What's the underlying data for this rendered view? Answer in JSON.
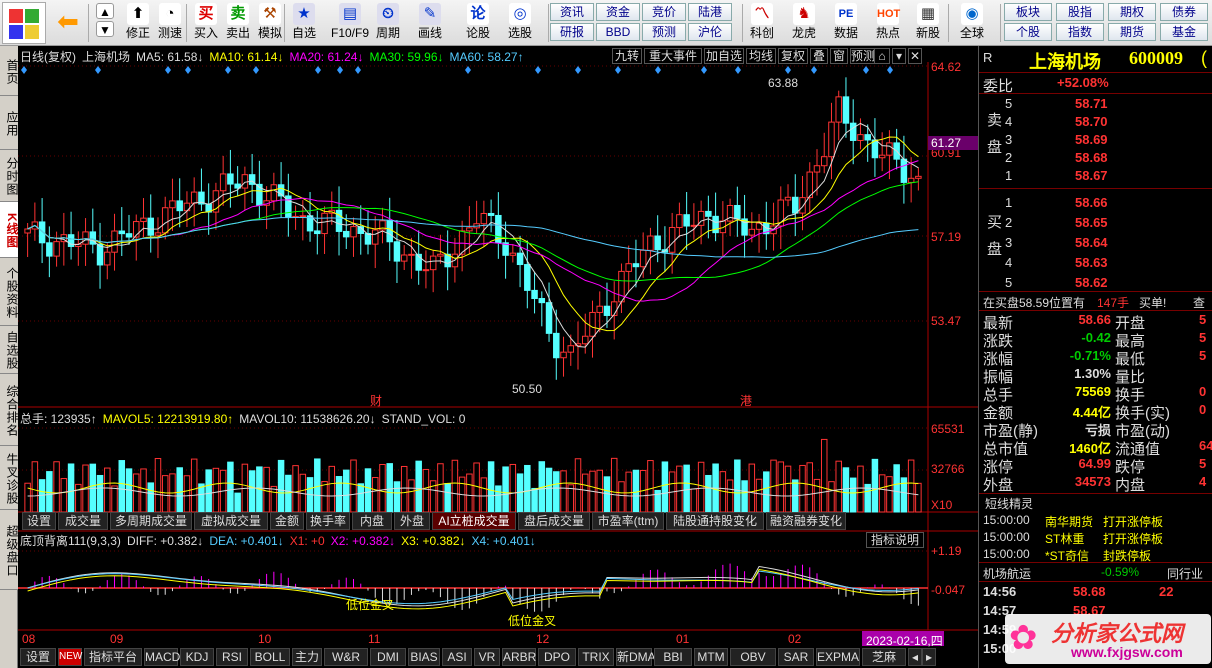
{
  "toolbar": {
    "buttons": [
      {
        "label": "修正",
        "icon": "wrench-icon",
        "glyph": "⬆",
        "bg": "#fff"
      },
      {
        "label": "测速",
        "icon": "speed-icon",
        "glyph": "◔",
        "bg": "#fff"
      },
      {
        "label": "买入",
        "icon": "buy-icon",
        "glyph": "买",
        "bg": "#fff",
        "color": "#d00"
      },
      {
        "label": "卖出",
        "icon": "sell-icon",
        "glyph": "卖",
        "bg": "#fff",
        "color": "#090"
      },
      {
        "label": "模拟",
        "icon": "hammer-icon",
        "glyph": "⚒",
        "bg": "#fff",
        "color": "#a40"
      },
      {
        "label": "自选",
        "icon": "star-icon",
        "glyph": "★",
        "bg": "#dde",
        "color": "#03c"
      },
      {
        "label": "F10/F9",
        "icon": "f10-icon",
        "glyph": "▤",
        "bg": "#dde",
        "color": "#03c"
      },
      {
        "label": "周期",
        "icon": "clock-icon",
        "glyph": "⏲",
        "bg": "#dde",
        "color": "#03c"
      },
      {
        "label": "画线",
        "icon": "pencil-icon",
        "glyph": "✎",
        "bg": "#dde",
        "color": "#03c"
      },
      {
        "label": "论股",
        "icon": "forum-icon",
        "glyph": "论",
        "bg": "#fff",
        "color": "#03c"
      },
      {
        "label": "选股",
        "icon": "pick-icon",
        "glyph": "◎",
        "bg": "#fff",
        "color": "#03c"
      },
      {
        "label": "科创",
        "icon": "chart-icon",
        "glyph": "〽",
        "bg": "#fff",
        "color": "#c00"
      },
      {
        "label": "龙虎",
        "icon": "dragon-icon",
        "glyph": "♞",
        "bg": "#fff",
        "color": "#c00"
      },
      {
        "label": "数据",
        "icon": "pe-icon",
        "glyph": "PE",
        "bg": "#fff",
        "color": "#03c"
      },
      {
        "label": "热点",
        "icon": "hot-icon",
        "glyph": "HOT",
        "bg": "#fff",
        "color": "#f40"
      },
      {
        "label": "新股",
        "icon": "calendar-icon",
        "glyph": "▦",
        "bg": "#fff",
        "color": "#333"
      },
      {
        "label": "全球",
        "icon": "globe-icon",
        "glyph": "◉",
        "bg": "#fff",
        "color": "#06c"
      }
    ],
    "grid": [
      "资讯",
      "资金",
      "竞价",
      "陆港",
      "研报",
      "BBD",
      "预测",
      "沪伦"
    ],
    "grid2": [
      "板块",
      "股指",
      "期权",
      "债券",
      "个股",
      "指数",
      "期货",
      "基金"
    ]
  },
  "left_tabs": [
    "首页",
    "应用",
    "分时图",
    "K线图",
    "个股资料",
    "自选股",
    "综合排名",
    "牛叉诊股",
    "超级盘口"
  ],
  "chart": {
    "title_items": [
      {
        "text": "日线(复权)",
        "color": "#ddd"
      },
      {
        "text": "上海机场",
        "color": "#ddd"
      },
      {
        "text": "MA5: 61.58↓",
        "color": "#ddd"
      },
      {
        "text": "MA10: 61.14↓",
        "color": "#ff0"
      },
      {
        "text": "MA20: 61.24↓",
        "color": "#f0f"
      },
      {
        "text": "MA30: 59.96↓",
        "color": "#0f0"
      },
      {
        "text": "MA60: 58.27↑",
        "color": "#5cf"
      }
    ],
    "top_buttons": [
      "九转",
      "重大事件",
      "加自选",
      "均线",
      "复权",
      "叠",
      "窗",
      "预测",
      "⌂",
      "▾",
      "✕"
    ],
    "price_labels": [
      "64.62",
      "60.91",
      "57.19",
      "53.47"
    ],
    "current_price": "61.27",
    "high_mark": "63.88",
    "low_mark": "50.50",
    "marker_cai": "财",
    "marker_gang": "港",
    "vol_title": [
      {
        "text": "总手: 123935↑",
        "color": "#ddd"
      },
      {
        "text": "MAVOL5: 12213919.80↑",
        "color": "#ff0"
      },
      {
        "text": "MAVOL10: 11538626.20↓",
        "color": "#ddd"
      },
      {
        "text": "STAND_VOL: 0",
        "color": "#ddd"
      }
    ],
    "vol_labels": [
      "65531",
      "32766",
      "X10"
    ],
    "indicator_tabs": [
      "设置",
      "成交量",
      "多周期成交量",
      "虚拟成交量",
      "金额",
      "换手率",
      "内盘",
      "外盘",
      "AI立桩成交量",
      "盘后成交量",
      "市盈率(ttm)",
      "陆股通持股变化",
      "融资融券变化"
    ],
    "active_indicator": "AI立桩成交量",
    "macd_title": [
      {
        "text": "底顶背离111(9,3,3)",
        "color": "#ddd"
      },
      {
        "text": "DIFF: +0.382↓",
        "color": "#ddd"
      },
      {
        "text": "DEA: +0.401↓",
        "color": "#5cf"
      },
      {
        "text": "X1: +0",
        "color": "#f33"
      },
      {
        "text": "X2: +0.382↓",
        "color": "#f0f"
      },
      {
        "text": "X3: +0.382↓",
        "color": "#ff0"
      },
      {
        "text": "X4: +0.401↓",
        "color": "#5cf"
      }
    ],
    "indicator_explain": "指标说明",
    "macd_labels": [
      "+1.19",
      "-0.047"
    ],
    "signal1": "低位金叉",
    "signal2": "低位金叉",
    "x_labels": [
      "08",
      "09",
      "10",
      "11",
      "12",
      "01",
      "02"
    ],
    "date_label": "2023-02-16,四",
    "bottom_tabs": [
      "设置",
      "NEW",
      "指标平台",
      "MACD",
      "KDJ",
      "RSI",
      "BOLL",
      "主力",
      "W&R",
      "DMI",
      "BIAS",
      "ASI",
      "VR",
      "ARBR",
      "DPO",
      "TRIX",
      "新DMA",
      "BBI",
      "MTM",
      "OBV",
      "SAR",
      "EXPMA",
      "芝麻"
    ]
  },
  "right": {
    "header_r": "R",
    "stock_name": "上海机场",
    "stock_code": "600009",
    "stock_code_more": "(",
    "weibi_label": "委比",
    "weibi_value": "+52.08%",
    "sell_label": "卖盘",
    "buy_label": "买盘",
    "asks": [
      {
        "n": "5",
        "p": "58.71"
      },
      {
        "n": "4",
        "p": "58.70"
      },
      {
        "n": "3",
        "p": "58.69"
      },
      {
        "n": "2",
        "p": "58.68"
      },
      {
        "n": "1",
        "p": "58.67"
      }
    ],
    "bids": [
      {
        "n": "1",
        "p": "58.66"
      },
      {
        "n": "2",
        "p": "58.65"
      },
      {
        "n": "3",
        "p": "58.64"
      },
      {
        "n": "4",
        "p": "58.63"
      },
      {
        "n": "5",
        "p": "58.62"
      }
    ],
    "buy_notice": "在买盘58.59位置有",
    "buy_notice_qty": "147手",
    "buy_notice_tag": "买单!",
    "buy_notice_more": "查",
    "quotes_left": [
      {
        "k": "最新",
        "v": "58.66",
        "c": "#f33"
      },
      {
        "k": "涨跌",
        "v": "-0.42",
        "c": "#0c0"
      },
      {
        "k": "涨幅",
        "v": "-0.71%",
        "c": "#0c0"
      },
      {
        "k": "振幅",
        "v": "1.30%",
        "c": "#ddd"
      },
      {
        "k": "总手",
        "v": "75569",
        "c": "#ff0"
      },
      {
        "k": "金额",
        "v": "4.44亿",
        "c": "#ff0"
      },
      {
        "k": "市盈(静)",
        "v": "亏损",
        "c": "#ddd"
      },
      {
        "k": "总市值",
        "v": "1460亿",
        "c": "#ff0"
      },
      {
        "k": "涨停",
        "v": "64.99",
        "c": "#f33"
      },
      {
        "k": "外盘",
        "v": "34573",
        "c": "#f33"
      }
    ],
    "quotes_right": [
      {
        "k": "开盘",
        "v": "5"
      },
      {
        "k": "最高",
        "v": "5"
      },
      {
        "k": "最低",
        "v": "5"
      },
      {
        "k": "量比",
        "v": ""
      },
      {
        "k": "换手",
        "v": "0"
      },
      {
        "k": "换手(实)",
        "v": "0"
      },
      {
        "k": "市盈(动)",
        "v": ""
      },
      {
        "k": "流通值",
        "v": "64"
      },
      {
        "k": "跌停",
        "v": "5"
      },
      {
        "k": "内盘",
        "v": "4"
      }
    ],
    "elves_title": "短线精灵",
    "elves": [
      {
        "t": "15:00:00",
        "name": "南华期货",
        "ev": "打开涨停板"
      },
      {
        "t": "15:00:00",
        "name": "ST林重",
        "ev": "打开涨停板"
      },
      {
        "t": "15:00:00",
        "name": "*ST奇信",
        "ev": "封跌停板"
      }
    ],
    "airport_label": "机场航运",
    "airport_pct": "-0.59%",
    "peer_label": "同行业",
    "ticks": [
      {
        "t": "14:56",
        "p": "58.68",
        "q": "22"
      },
      {
        "t": "14:57",
        "p": "58.67",
        "q": ""
      },
      {
        "t": "14:59",
        "p": "",
        "q": ""
      },
      {
        "t": "15:00",
        "p": "",
        "q": ""
      }
    ],
    "watermark": "分析家公式网",
    "watermark_url": "www.fxjgsw.com"
  },
  "chart_data": {
    "type": "candlestick",
    "ylim": [
      49.5,
      65.5
    ],
    "high": 63.88,
    "low": 50.5,
    "last_ma": {
      "MA5": 61.58,
      "MA10": 61.14,
      "MA20": 61.24,
      "MA30": 59.96,
      "MA60": 58.27
    },
    "vol_ylim": [
      0,
      65531
    ],
    "macd_ylim": [
      -0.8,
      1.19
    ]
  }
}
